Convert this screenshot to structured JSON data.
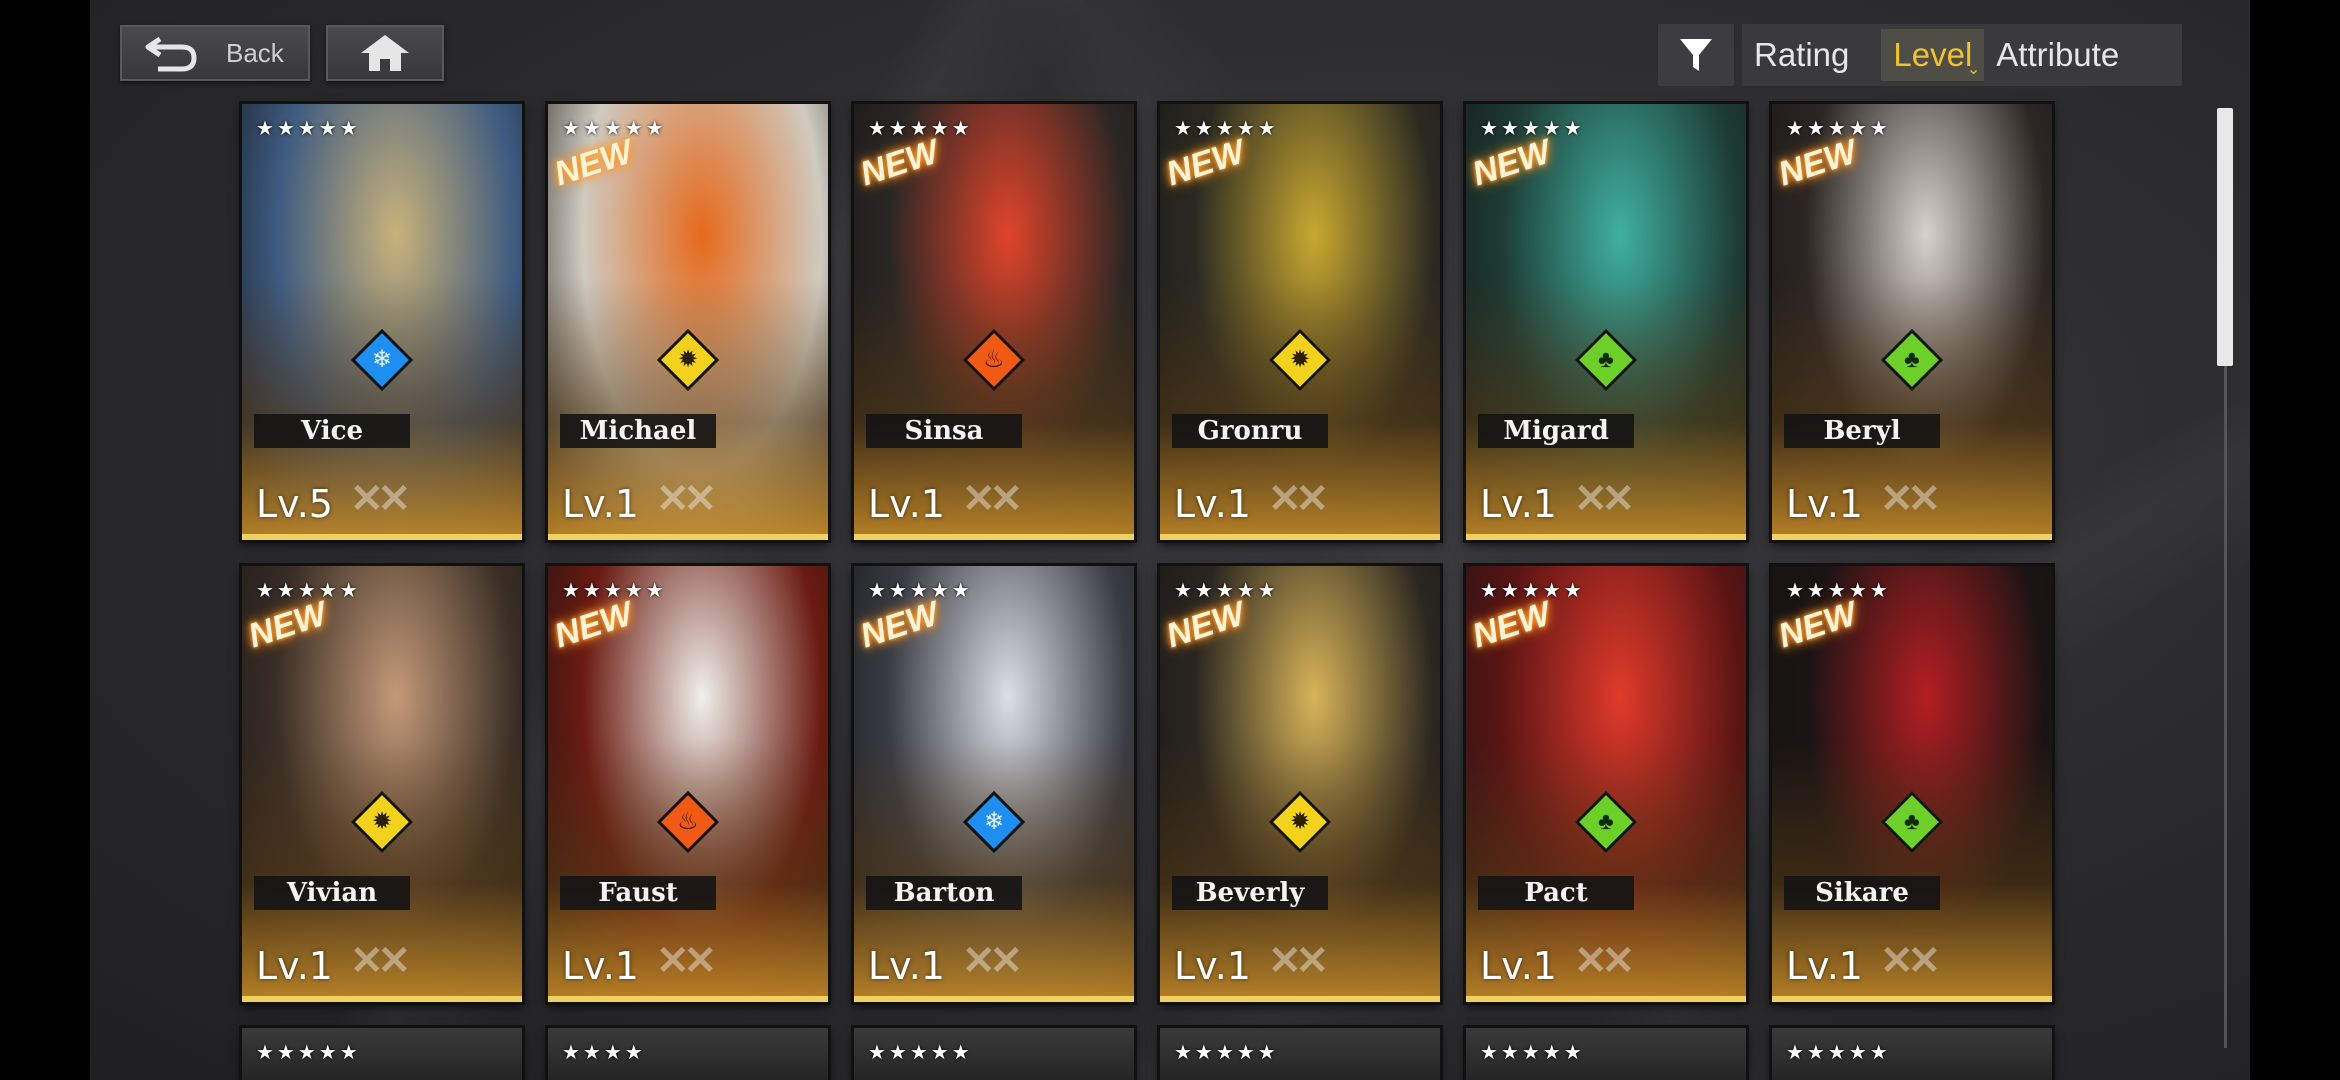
{
  "header": {
    "back_label": "Back",
    "back_icon": "back-arrow-icon",
    "home_icon": "home-icon",
    "filter_icon": "filter-funnel-icon",
    "sort_tabs": [
      {
        "label": "Rating",
        "active": false
      },
      {
        "label": "Level",
        "active": true
      },
      {
        "label": "Attribute",
        "active": false
      }
    ],
    "active_color": "#f2c230"
  },
  "characters": [
    {
      "name": "Vice",
      "level": "Lv.5",
      "new": false,
      "attribute": "ice",
      "stars": "★★★★★",
      "palette": [
        "#3d5a80",
        "#c9b27a"
      ]
    },
    {
      "name": "Michael",
      "level": "Lv.1",
      "new": true,
      "attribute": "light",
      "stars": "★★★★★",
      "palette": [
        "#cfcac0",
        "#e66a1c"
      ]
    },
    {
      "name": "Sinsa",
      "level": "Lv.1",
      "new": true,
      "attribute": "fire",
      "stars": "★★★★★",
      "palette": [
        "#2a2624",
        "#e0442a"
      ]
    },
    {
      "name": "Gronru",
      "level": "Lv.1",
      "new": true,
      "attribute": "light",
      "stars": "★★★★★",
      "palette": [
        "#2b2a22",
        "#c9a830"
      ]
    },
    {
      "name": "Migard",
      "level": "Lv.1",
      "new": true,
      "attribute": "nature",
      "stars": "★★★★★",
      "palette": [
        "#1d3a33",
        "#3fb0a0"
      ]
    },
    {
      "name": "Beryl",
      "level": "Lv.1",
      "new": true,
      "attribute": "nature",
      "stars": "★★★★★",
      "palette": [
        "#2c2624",
        "#d8d2cc"
      ]
    },
    {
      "name": "Vivian",
      "level": "Lv.1",
      "new": true,
      "attribute": "light",
      "stars": "★★★★★",
      "palette": [
        "#3a2e26",
        "#c49a78"
      ]
    },
    {
      "name": "Faust",
      "level": "Lv.1",
      "new": true,
      "attribute": "fire",
      "stars": "★★★★★",
      "palette": [
        "#6a1a12",
        "#f0f0ea"
      ]
    },
    {
      "name": "Barton",
      "level": "Lv.1",
      "new": true,
      "attribute": "ice",
      "stars": "★★★★★",
      "palette": [
        "#3a3c44",
        "#dcdfe6"
      ]
    },
    {
      "name": "Beverly",
      "level": "Lv.1",
      "new": true,
      "attribute": "light",
      "stars": "★★★★★",
      "palette": [
        "#2a2620",
        "#d8b458"
      ]
    },
    {
      "name": "Pact",
      "level": "Lv.1",
      "new": true,
      "attribute": "nature",
      "stars": "★★★★★",
      "palette": [
        "#5a1414",
        "#e03a2a"
      ]
    },
    {
      "name": "Sikare",
      "level": "Lv.1",
      "new": true,
      "attribute": "nature",
      "stars": "★★★★★",
      "palette": [
        "#1a1414",
        "#b41e22"
      ]
    }
  ],
  "partial_row_stars": [
    "★★★★★",
    "★★★★",
    "★★★★★",
    "★★★★★",
    "★★★★★",
    "★★★★★"
  ],
  "new_tag_text": "NEW"
}
